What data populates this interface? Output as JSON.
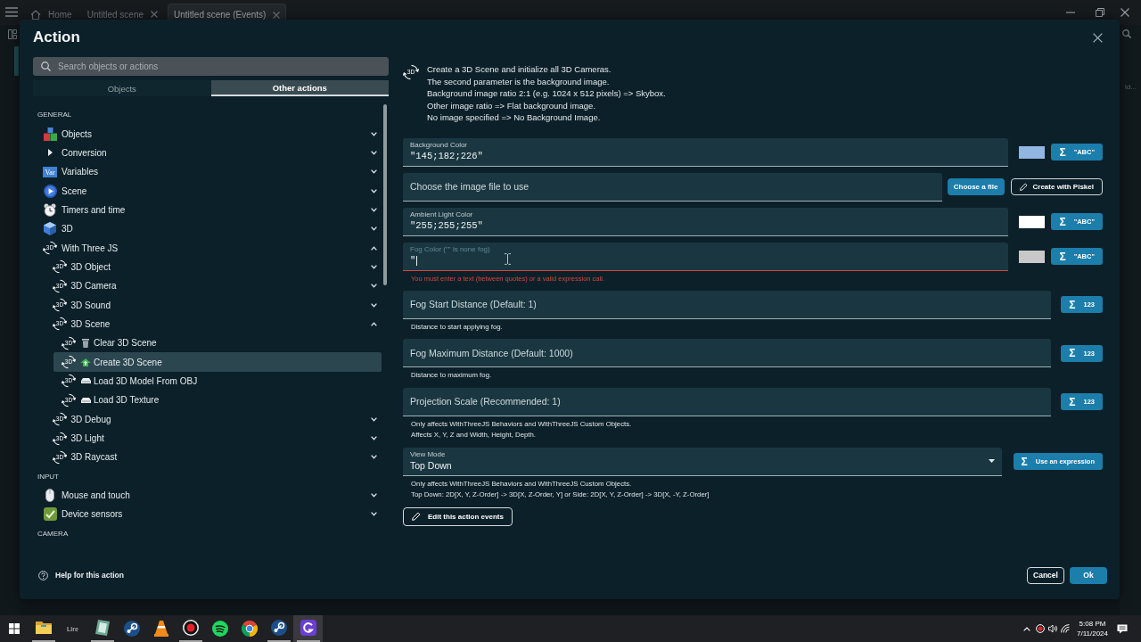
{
  "window": {
    "tabs": [
      {
        "label": "Home",
        "kind": "home",
        "selected": false
      },
      {
        "label": "Untitled scene",
        "kind": "document",
        "selected": false
      },
      {
        "label": "Untitled scene (Events)",
        "kind": "document",
        "selected": true
      }
    ],
    "side_hint": "id..."
  },
  "dialog": {
    "title": "Action",
    "search": {
      "placeholder": "Search objects or actions"
    },
    "tabs": [
      {
        "label": "Objects",
        "selected": false
      },
      {
        "label": "Other actions",
        "selected": true
      }
    ],
    "sections": [
      {
        "header": "GENERAL",
        "items": [
          {
            "label": "Objects",
            "kind": "objects",
            "expanded": false,
            "selected": false
          },
          {
            "label": "Conversion",
            "kind": "conversion",
            "expanded": false,
            "selected": false
          },
          {
            "label": "Variables",
            "kind": "variables",
            "icon_text": "Var",
            "expanded": false,
            "selected": false
          },
          {
            "label": "Scene",
            "kind": "scene",
            "expanded": false,
            "selected": false
          },
          {
            "label": "Timers and time",
            "kind": "timers",
            "expanded": false,
            "selected": false
          },
          {
            "label": "3D",
            "kind": "cube",
            "expanded": false,
            "selected": false
          },
          {
            "label": "With Three JS",
            "kind": "threejs",
            "icon_text": "3D",
            "expanded": true,
            "selected": false,
            "children": [
              {
                "label": "3D Object",
                "kind": "threejs",
                "icon_text": "3D",
                "expanded": false,
                "selected": false
              },
              {
                "label": "3D Camera",
                "kind": "threejs",
                "icon_text": "3D",
                "expanded": false,
                "selected": false
              },
              {
                "label": "3D Sound",
                "kind": "threejs",
                "icon_text": "3D",
                "expanded": false,
                "selected": false
              },
              {
                "label": "3D Scene",
                "kind": "threejs",
                "icon_text": "3D",
                "expanded": true,
                "selected": false,
                "children": [
                  {
                    "label": "Clear 3D Scene",
                    "kind": "trash",
                    "icon_text": "3D",
                    "selected": false
                  },
                  {
                    "label": "Create 3D Scene",
                    "kind": "upload",
                    "icon_text": "3D",
                    "selected": true
                  },
                  {
                    "label": "Load 3D Model From OBJ",
                    "kind": "tray",
                    "icon_text": "3D",
                    "selected": false
                  },
                  {
                    "label": "Load 3D Texture",
                    "kind": "tray",
                    "icon_text": "3D",
                    "selected": false
                  }
                ]
              },
              {
                "label": "3D Debug",
                "kind": "threejs",
                "icon_text": "3D",
                "expanded": false,
                "selected": false
              },
              {
                "label": "3D Light",
                "kind": "threejs",
                "icon_text": "3D",
                "expanded": false,
                "selected": false
              },
              {
                "label": "3D Raycast",
                "kind": "threejs",
                "icon_text": "3D",
                "expanded": false,
                "selected": false
              }
            ]
          }
        ]
      },
      {
        "header": "INPUT",
        "items": [
          {
            "label": "Mouse and touch",
            "kind": "mouse",
            "expanded": false,
            "selected": false
          },
          {
            "label": "Device sensors",
            "kind": "sensors",
            "expanded": false,
            "selected": false
          }
        ]
      },
      {
        "header": "CAMERA"
      }
    ],
    "help": "Help for this action",
    "description": {
      "icon_text": "3D",
      "lines": [
        "Create a 3D Scene and initialize all 3D Cameras.",
        "The second parameter is the background image.",
        "Background image ratio 2:1 (e.g. 1024 x 512 pixels) => Skybox.",
        "Other image ratio => Flat background image.",
        "No image specified => No Background Image."
      ]
    },
    "params": [
      {
        "kind": "color",
        "label": "Background Color",
        "value": "\"145;182;226\"",
        "color": "#91b6e2",
        "focused": false,
        "button": {
          "symbol": "Σ",
          "label": "\"ABC\""
        }
      },
      {
        "kind": "file",
        "placeholder": "Choose the image file to use",
        "buttons": [
          {
            "kind": "primary",
            "label": "Choose a file"
          },
          {
            "kind": "outline",
            "label": "Create with Piskel"
          }
        ]
      },
      {
        "kind": "color",
        "label": "Ambient Light Color",
        "value": "\"255;255;255\"",
        "color": "#ffffff",
        "focused": false,
        "button": {
          "symbol": "Σ",
          "label": "\"ABC\""
        }
      },
      {
        "kind": "color",
        "label": "Fog Color (\"\" is none fog)",
        "value": "\"",
        "color": "#c8c8c8",
        "focused": true,
        "error": "You must enter a text (between quotes) or a valid expression call.",
        "button": {
          "symbol": "Σ",
          "label": "\"ABC\""
        }
      },
      {
        "kind": "number",
        "placeholder": "Fog Start Distance (Default: 1)",
        "help": [
          "Distance to start applying fog."
        ],
        "button": {
          "symbol": "Σ",
          "label": "123"
        }
      },
      {
        "kind": "number",
        "placeholder": "Fog Maximum Distance (Default: 1000)",
        "help": [
          "Distance to maximum fog."
        ],
        "button": {
          "symbol": "Σ",
          "label": "123"
        }
      },
      {
        "kind": "number",
        "placeholder": "Projection Scale (Recommended: 1)",
        "help": [
          "Only affects WithThreeJS Behaviors and WithThreeJS Custom Objects.",
          "Affects X, Y, Z and Width, Height, Depth."
        ],
        "button": {
          "symbol": "Σ",
          "label": "123"
        }
      },
      {
        "kind": "select",
        "label": "View Mode",
        "value": "Top Down",
        "help": [
          "Only affects WithThreeJS Behaviors and WithThreeJS Custom Objects.",
          "Top Down: 2D[X, Y, Z-Order] -> 3D[X, Z-Order, Y] or Side: 2D[X, Y, Z-Order] -> 3D[X, -Y, Z-Order]"
        ],
        "button": {
          "symbol": "Σ",
          "label": "Use an expression"
        }
      }
    ],
    "edit_button": "Edit this action events",
    "buttons": [
      {
        "label": "Cancel",
        "kind": "secondary"
      },
      {
        "label": "Ok",
        "kind": "primary"
      }
    ]
  },
  "taskbar": {
    "apps": [
      {
        "kind": "folder",
        "running": true,
        "selected": false
      },
      {
        "kind": "wordmark",
        "label": "Lire",
        "running": false,
        "selected": false
      },
      {
        "kind": "notebook",
        "running": true,
        "selected": false
      },
      {
        "kind": "disc",
        "running": false,
        "selected": false
      },
      {
        "kind": "cone",
        "running": false,
        "selected": false
      },
      {
        "kind": "record",
        "running": true,
        "selected": false
      },
      {
        "kind": "waves",
        "running": false,
        "selected": false
      },
      {
        "kind": "ring",
        "running": false,
        "selected": false
      },
      {
        "kind": "disc",
        "running": true,
        "selected": false
      },
      {
        "kind": "logo",
        "running": true,
        "selected": true
      }
    ],
    "time": "5:08 PM",
    "date": "7/11/2024"
  }
}
